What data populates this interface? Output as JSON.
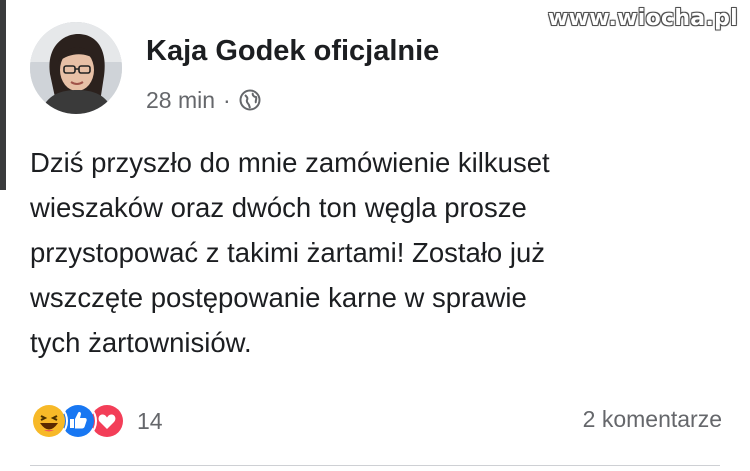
{
  "watermark": "www.wiocha.pl",
  "post": {
    "author": "Kaja Godek oficjalnie",
    "time": "28 min",
    "separator": "·",
    "privacy_icon": "globe-icon",
    "text_lines": [
      "Dziś przyszło do mnie zamówienie kilkuset",
      "wieszaków oraz dwóch ton węgla prosze",
      "przystopować z takimi żartami! Zostało już",
      "wszczęte postępowanie karne w sprawie",
      "tych żartownisiów."
    ],
    "reactions": {
      "icons": [
        "haha-icon",
        "like-icon",
        "love-icon"
      ],
      "count": "14"
    },
    "comments": "2 komentarze"
  },
  "colors": {
    "text": "#1c1e21",
    "secondary": "#65676b",
    "like": "#1877f2",
    "love": "#f33e58",
    "haha": "#f7b928"
  }
}
